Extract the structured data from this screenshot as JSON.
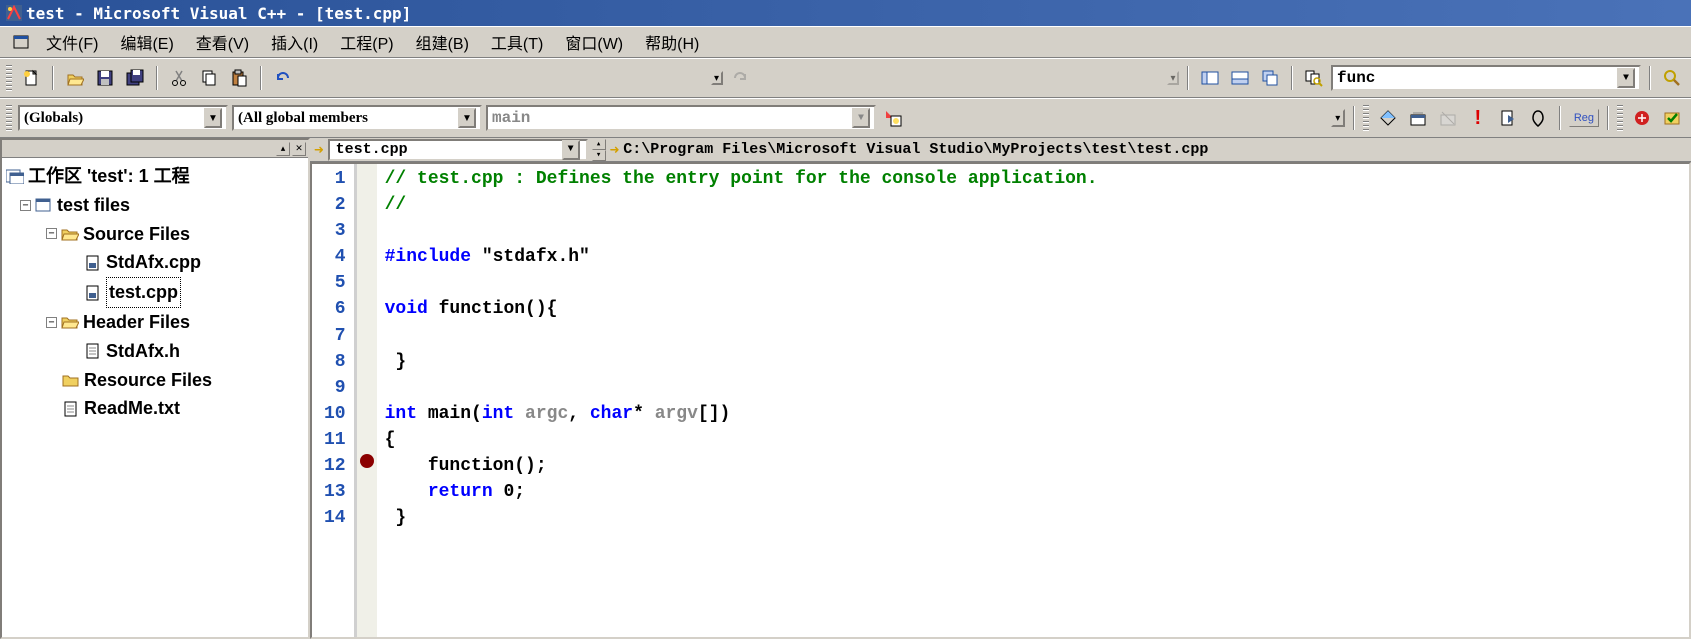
{
  "title": "test - Microsoft Visual C++ - [test.cpp]",
  "menu": {
    "file": "文件(F)",
    "edit": "编辑(E)",
    "view": "查看(V)",
    "insert": "插入(I)",
    "project": "工程(P)",
    "build": "组建(B)",
    "tools": "工具(T)",
    "window": "窗口(W)",
    "help": "帮助(H)"
  },
  "toolbar2": {
    "search_value": "func"
  },
  "toolbar3": {
    "scope": "(Globals)",
    "members": "(All global members",
    "func": "main",
    "reg_label": "Reg"
  },
  "tabs": {
    "current_file": "test.cpp",
    "full_path": "C:\\Program Files\\Microsoft Visual Studio\\MyProjects\\test\\test.cpp"
  },
  "tree": {
    "workspace": "工作区 'test': 1 工程",
    "project": "test files",
    "source_folder": "Source Files",
    "source_files": [
      "StdAfx.cpp",
      "test.cpp"
    ],
    "header_folder": "Header Files",
    "header_files": [
      "StdAfx.h"
    ],
    "resource_folder": "Resource Files",
    "readme": "ReadMe.txt"
  },
  "code": {
    "lines": [
      {
        "n": 1,
        "html": "<span class='c-comment'>// test.cpp : Defines the entry point for the console application.</span>"
      },
      {
        "n": 2,
        "html": "<span class='c-comment'>//</span>"
      },
      {
        "n": 3,
        "html": ""
      },
      {
        "n": 4,
        "html": "<span class='c-pp'>#include </span><span class='c-str'>\"stdafx.h\"</span>"
      },
      {
        "n": 5,
        "html": ""
      },
      {
        "n": 6,
        "html": "<span class='c-keyword'>void</span> function(){"
      },
      {
        "n": 7,
        "html": ""
      },
      {
        "n": 8,
        "html": " }"
      },
      {
        "n": 9,
        "html": ""
      },
      {
        "n": 10,
        "html": "<span class='c-keyword'>int</span> main(<span class='c-keyword'>int</span> <span class='c-gray'>argc</span>, <span class='c-keyword'>char</span>* <span class='c-gray'>argv</span>[])"
      },
      {
        "n": 11,
        "html": "{"
      },
      {
        "n": 12,
        "html": "    function();",
        "bp": true
      },
      {
        "n": 13,
        "html": "    <span class='c-keyword'>return</span> 0;"
      },
      {
        "n": 14,
        "html": " }"
      }
    ]
  }
}
